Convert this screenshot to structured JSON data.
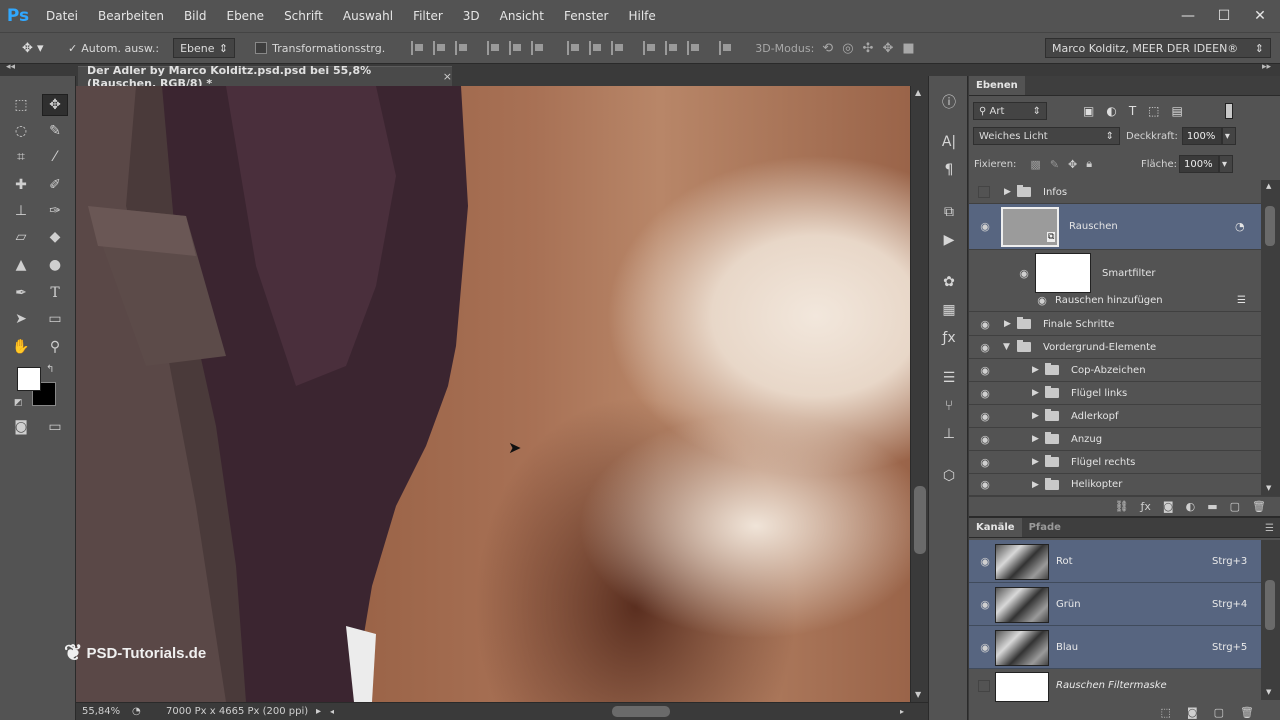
{
  "app": {
    "logo": "Ps"
  },
  "menu": [
    "Datei",
    "Bearbeiten",
    "Bild",
    "Ebene",
    "Schrift",
    "Auswahl",
    "Filter",
    "3D",
    "Ansicht",
    "Fenster",
    "Hilfe"
  ],
  "window_controls": {
    "minimize": "—",
    "maximize": "☐",
    "close": "✕"
  },
  "options": {
    "auto_select_label": "Autom. ausw.:",
    "auto_select_target": "Ebene",
    "transform_label": "Transformationsstrg.",
    "mode_3d_label": "3D-Modus:",
    "workspace": "Marco Kolditz, MEER DER IDEEN®"
  },
  "document": {
    "tab_title": "Der Adler by Marco Kolditz.psd.psd bei 55,8% (Rauschen, RGB/8) *",
    "close": "×",
    "watermark": "PSD-Tutorials.de",
    "zoom": "55,84%",
    "doc_info": "7000 Px x 4665 Px (200 ppi)"
  },
  "layers_panel": {
    "tab": "Ebenen",
    "filter_kind": "Art",
    "blend_mode": "Weiches Licht",
    "opacity_label": "Deckkraft:",
    "opacity": "100%",
    "lock_label": "Fixieren:",
    "fill_label": "Fläche:",
    "fill": "100%",
    "layers": {
      "infos": "Infos",
      "rauschen": "Rauschen",
      "smartfilter": "Smartfilter",
      "rauschen_add": "Rauschen hinzufügen",
      "finale": "Finale Schritte",
      "vordergrund": "Vordergrund-Elemente",
      "cop": "Cop-Abzeichen",
      "fluegel_links": "Flügel links",
      "adlerkopf": "Adlerkopf",
      "anzug": "Anzug",
      "fluegel_rechts": "Flügel rechts",
      "helikopter": "Helikopter"
    }
  },
  "channels_panel": {
    "tabs": [
      "Kanäle",
      "Pfade"
    ],
    "channels": [
      {
        "name": "Rot",
        "shortcut": "Strg+3"
      },
      {
        "name": "Grün",
        "shortcut": "Strg+4"
      },
      {
        "name": "Blau",
        "shortcut": "Strg+5"
      }
    ],
    "mask": "Rauschen Filtermaske"
  }
}
